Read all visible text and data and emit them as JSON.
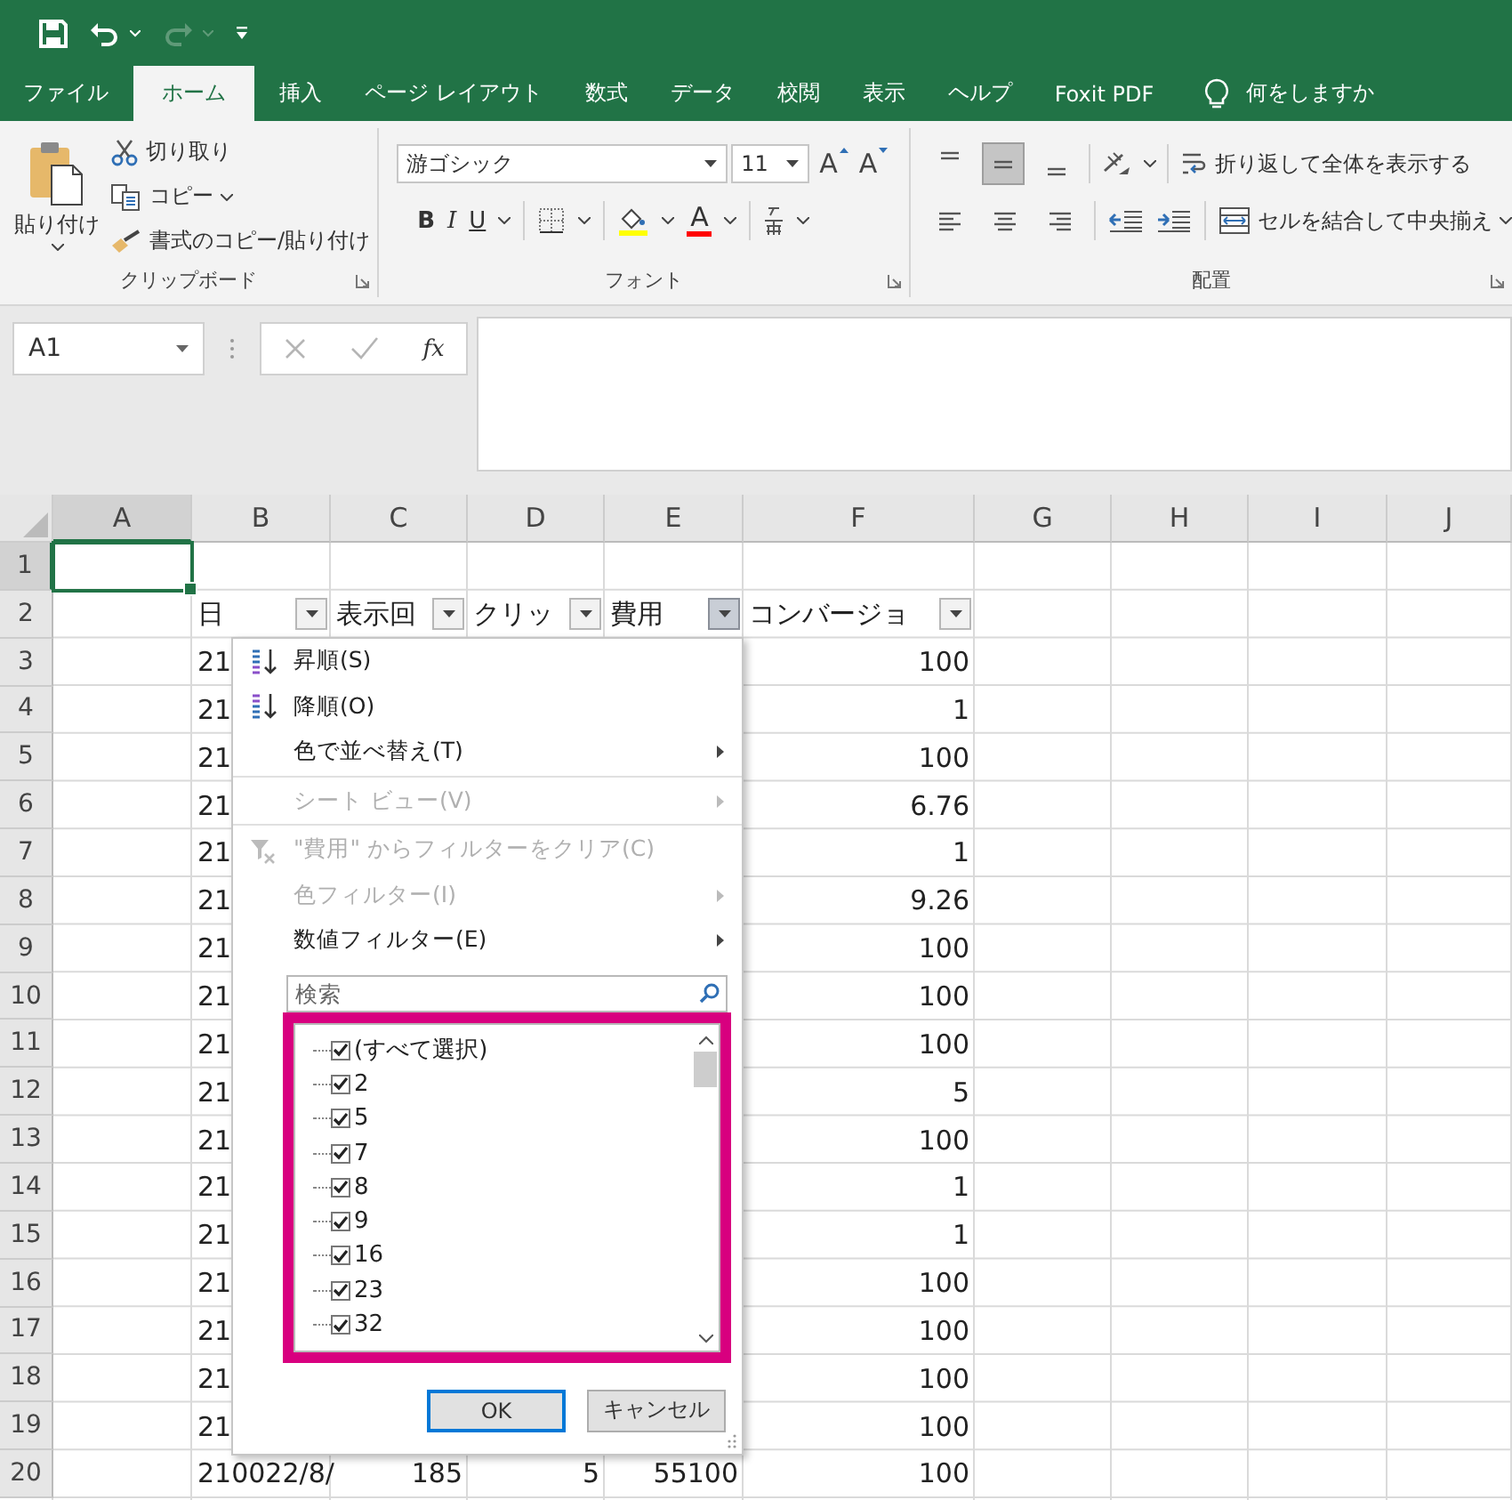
{
  "quick_access": [
    {
      "kind": "save",
      "disabled": false
    },
    {
      "kind": "undo",
      "disabled": false
    },
    {
      "kind": "redo",
      "disabled": true
    },
    {
      "kind": "customize",
      "disabled": false
    }
  ],
  "tabs": [
    {
      "label": "ファイル",
      "selected": false
    },
    {
      "label": "ホーム",
      "selected": true
    },
    {
      "label": "挿入",
      "selected": false
    },
    {
      "label": "ページ レイアウト",
      "selected": false
    },
    {
      "label": "数式",
      "selected": false
    },
    {
      "label": "データ",
      "selected": false
    },
    {
      "label": "校閲",
      "selected": false
    },
    {
      "label": "表示",
      "selected": false
    },
    {
      "label": "ヘルプ",
      "selected": false
    },
    {
      "label": "Foxit PDF",
      "selected": false
    }
  ],
  "tell_me": "何をしますか",
  "clipboard": {
    "paste": "貼り付け",
    "cut": "切り取り",
    "copy": "コピー",
    "format_painter": "書式のコピー/貼り付け",
    "label": "クリップボード"
  },
  "font": {
    "name": "游ゴシック",
    "size": "11",
    "grow": "A",
    "shrink": "A",
    "bold": "B",
    "italic": "I",
    "underline": "U",
    "font_color": "A",
    "label": "フォント"
  },
  "alignment": {
    "vertical": [
      {
        "kind": "top",
        "selected": false
      },
      {
        "kind": "middle",
        "selected": true
      },
      {
        "kind": "bottom",
        "selected": false
      }
    ],
    "horizontal": [
      {
        "kind": "left",
        "selected": false
      },
      {
        "kind": "center",
        "selected": false
      },
      {
        "kind": "right",
        "selected": false
      }
    ],
    "wrap_text": "折り返して全体を表示する",
    "merge": "セルを結合して中央揃え",
    "label": "配置"
  },
  "formula_bar": {
    "name_box": "A1",
    "cancel_disabled": true,
    "enter_disabled": true,
    "function_button": "fx"
  },
  "columns": [
    {
      "label": "A",
      "selected": true
    },
    {
      "label": "B",
      "selected": false
    },
    {
      "label": "C",
      "selected": false
    },
    {
      "label": "D",
      "selected": false
    },
    {
      "label": "E",
      "selected": false
    },
    {
      "label": "F",
      "selected": false
    },
    {
      "label": "G",
      "selected": false
    },
    {
      "label": "H",
      "selected": false
    },
    {
      "label": "I",
      "selected": false
    },
    {
      "label": "J",
      "selected": false
    }
  ],
  "rows": [
    {
      "label": "1",
      "selected": true,
      "kind": "data"
    },
    {
      "label": "2",
      "selected": false,
      "kind": "filter_header",
      "b": {
        "text": "日",
        "open": false
      },
      "c": {
        "text": "表示回",
        "open": false
      },
      "d": {
        "text": "クリッ",
        "open": false
      },
      "e": {
        "text": "費用",
        "open": true
      },
      "f": {
        "text": "コンバージョ",
        "open": false
      }
    },
    {
      "label": "3",
      "selected": false,
      "kind": "data",
      "b": "21",
      "f": "100"
    },
    {
      "label": "4",
      "selected": false,
      "kind": "data",
      "b": "21",
      "f": "1"
    },
    {
      "label": "5",
      "selected": false,
      "kind": "data",
      "b": "21",
      "f": "100"
    },
    {
      "label": "6",
      "selected": false,
      "kind": "data",
      "b": "21",
      "f": "6.76"
    },
    {
      "label": "7",
      "selected": false,
      "kind": "data",
      "b": "21",
      "f": "1"
    },
    {
      "label": "8",
      "selected": false,
      "kind": "data",
      "b": "21",
      "f": "9.26"
    },
    {
      "label": "9",
      "selected": false,
      "kind": "data",
      "b": "21",
      "f": "100"
    },
    {
      "label": "10",
      "selected": false,
      "kind": "data",
      "b": "21",
      "f": "100"
    },
    {
      "label": "11",
      "selected": false,
      "kind": "data",
      "b": "21",
      "f": "100"
    },
    {
      "label": "12",
      "selected": false,
      "kind": "data",
      "b": "21",
      "f": "5"
    },
    {
      "label": "13",
      "selected": false,
      "kind": "data",
      "b": "21",
      "f": "100"
    },
    {
      "label": "14",
      "selected": false,
      "kind": "data",
      "b": "21",
      "f": "1"
    },
    {
      "label": "15",
      "selected": false,
      "kind": "data",
      "b": "21",
      "f": "1"
    },
    {
      "label": "16",
      "selected": false,
      "kind": "data",
      "b": "21",
      "f": "100"
    },
    {
      "label": "17",
      "selected": false,
      "kind": "data",
      "b": "21",
      "f": "100"
    },
    {
      "label": "18",
      "selected": false,
      "kind": "data",
      "b": "21",
      "f": "100"
    },
    {
      "label": "19",
      "selected": false,
      "kind": "data",
      "b": "21",
      "f": "100"
    },
    {
      "label": "20",
      "selected": false,
      "kind": "data",
      "b": "210022/8/",
      "c": "185",
      "d": "5",
      "e": "55100",
      "f": "100"
    }
  ],
  "filter_menu": {
    "items": [
      {
        "label": "昇順(S)",
        "kind": "sort_ascending",
        "disabled": false,
        "submenu": false,
        "separator_after": false
      },
      {
        "label": "降順(O)",
        "kind": "sort_descending",
        "disabled": false,
        "submenu": false,
        "separator_after": false
      },
      {
        "label": "色で並べ替え(T)",
        "kind": "plain",
        "disabled": false,
        "submenu": true,
        "separator_after": true
      },
      {
        "label": "シート ビュー(V)",
        "kind": "plain",
        "disabled": true,
        "submenu": true,
        "separator_after": true
      },
      {
        "label": "\"費用\" からフィルターをクリア(C)",
        "kind": "clear_filter",
        "disabled": true,
        "submenu": false,
        "separator_after": false
      },
      {
        "label": "色フィルター(I)",
        "kind": "plain",
        "disabled": true,
        "submenu": true,
        "separator_after": false
      },
      {
        "label": "数値フィルター(E)",
        "kind": "plain",
        "disabled": false,
        "submenu": true,
        "separator_after": false
      }
    ],
    "search": {
      "placeholder": "検索"
    },
    "highlighted": true,
    "values": [
      {
        "label": "(すべて選択)",
        "checked": true
      },
      {
        "label": "2",
        "checked": true
      },
      {
        "label": "5",
        "checked": true
      },
      {
        "label": "7",
        "checked": true
      },
      {
        "label": "8",
        "checked": true
      },
      {
        "label": "9",
        "checked": true
      },
      {
        "label": "16",
        "checked": true
      },
      {
        "label": "23",
        "checked": true
      },
      {
        "label": "32",
        "checked": true
      }
    ],
    "buttons": [
      {
        "label": "OK",
        "default": true
      },
      {
        "label": "キャンセル",
        "default": false
      }
    ]
  }
}
